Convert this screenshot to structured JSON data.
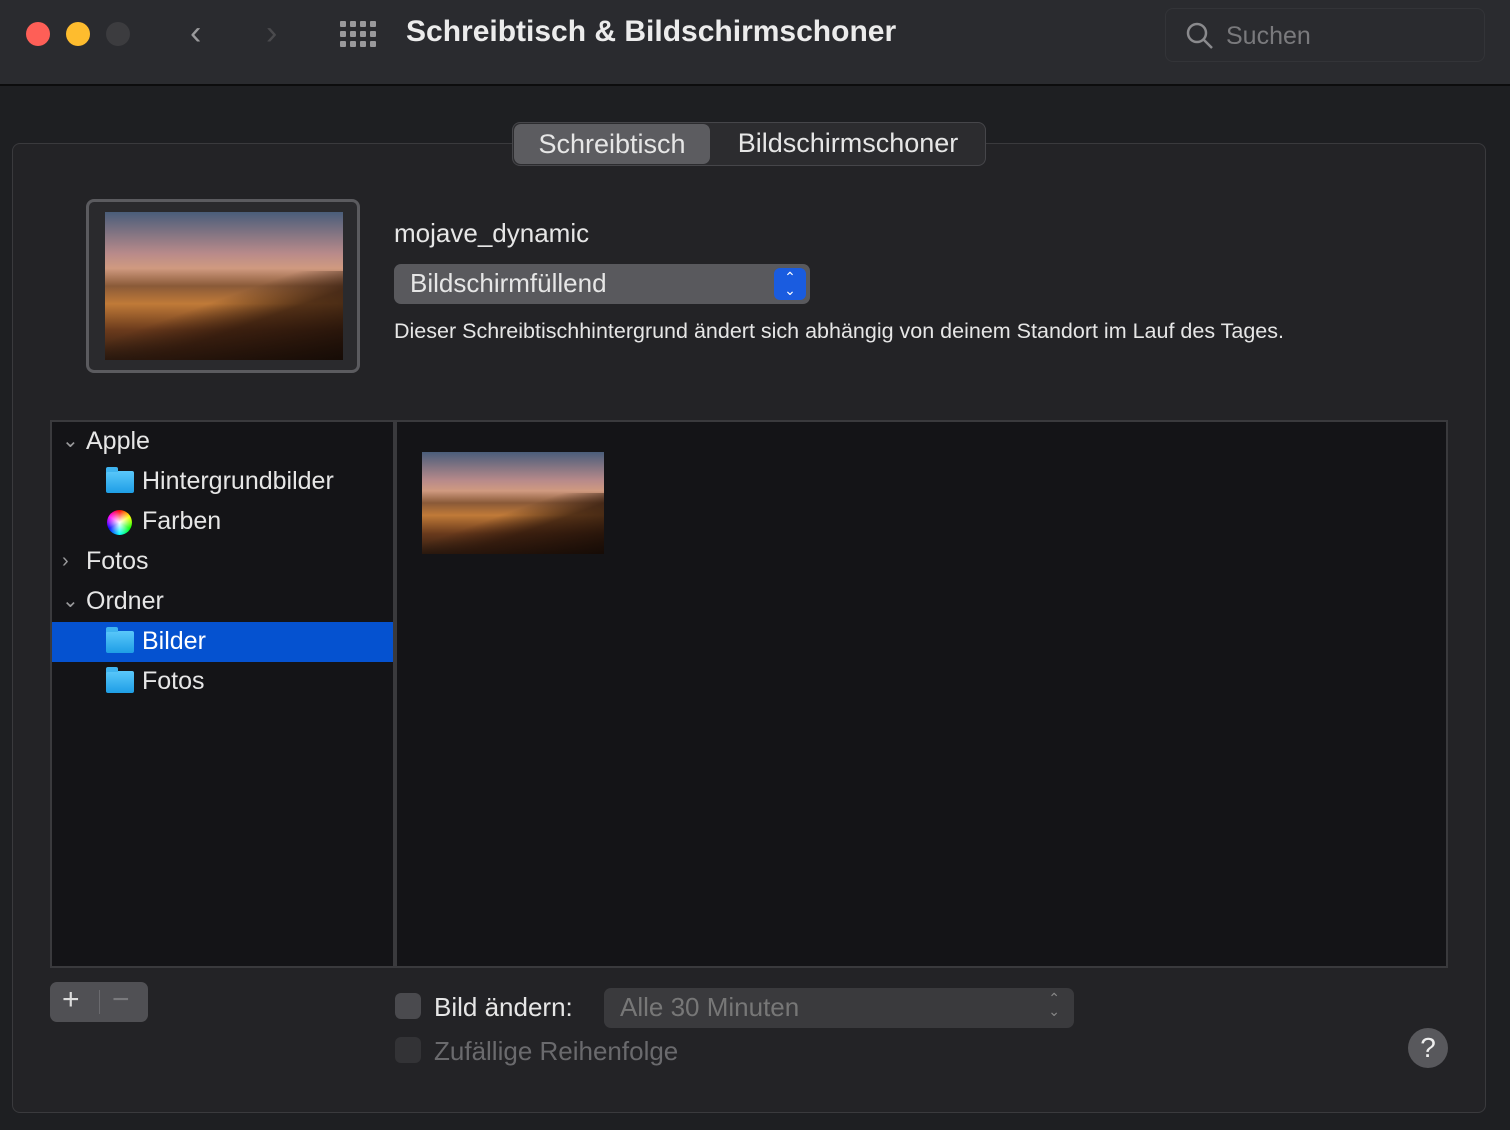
{
  "window": {
    "title": "Schreibtisch & Bildschirmschoner",
    "search_placeholder": "Suchen"
  },
  "tabs": [
    {
      "label": "Schreibtisch",
      "active": true
    },
    {
      "label": "Bildschirmschoner",
      "active": false
    }
  ],
  "wallpaper": {
    "name": "mojave_dynamic",
    "fit": "Bildschirmfüllend",
    "description": "Dieser Schreibtischhintergrund ändert sich abhängig von deinem Standort im Lauf des Tages."
  },
  "sidebar": {
    "items": [
      {
        "label": "Apple",
        "type": "group",
        "expanded": true
      },
      {
        "label": "Hintergrundbilder",
        "type": "folder"
      },
      {
        "label": "Farben",
        "type": "colors"
      },
      {
        "label": "Fotos",
        "type": "group",
        "expanded": false
      },
      {
        "label": "Ordner",
        "type": "group",
        "expanded": true
      },
      {
        "label": "Bilder",
        "type": "folder",
        "selected": true
      },
      {
        "label": "Fotos",
        "type": "folder"
      }
    ]
  },
  "controls": {
    "add": "+",
    "remove": "−",
    "change_picture_label": "Bild ändern:",
    "change_picture_checked": false,
    "interval": "Alle 30 Minuten",
    "random_order_label": "Zufällige Reihenfolge",
    "random_order_checked": false,
    "help": "?"
  },
  "colors": {
    "accent": "#0552d0",
    "close": "#fe5f57",
    "minimize": "#febc2e"
  }
}
